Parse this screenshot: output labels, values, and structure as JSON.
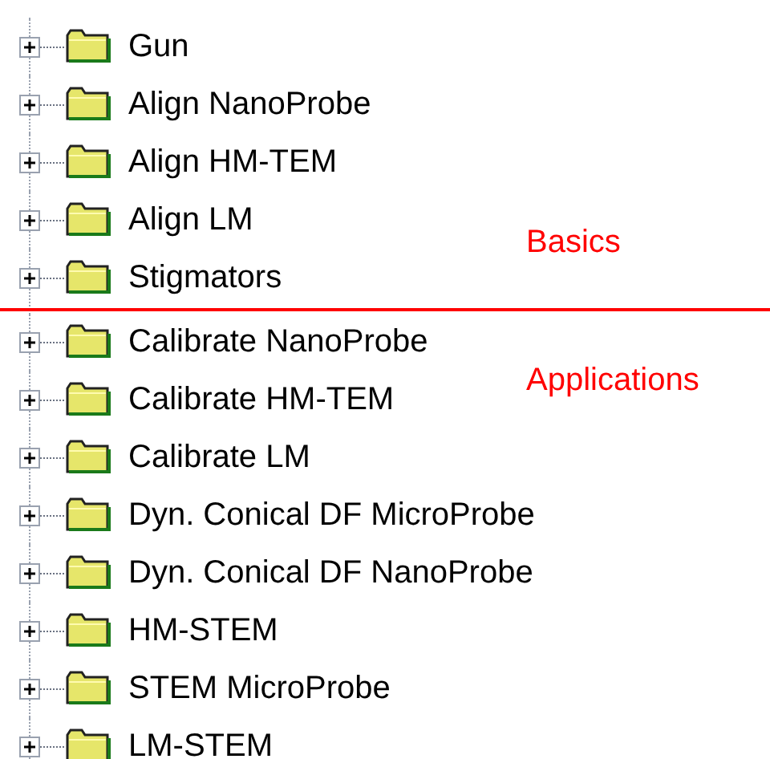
{
  "groups": [
    {
      "annotation": "Basics",
      "items": [
        {
          "label": "Gun",
          "expanded": false
        },
        {
          "label": "Align NanoProbe",
          "expanded": false
        },
        {
          "label": "Align HM-TEM",
          "expanded": false
        },
        {
          "label": "Align LM",
          "expanded": false
        },
        {
          "label": "Stigmators",
          "expanded": false
        }
      ]
    },
    {
      "annotation": "Applications",
      "items": [
        {
          "label": "Calibrate NanoProbe",
          "expanded": false
        },
        {
          "label": "Calibrate HM-TEM",
          "expanded": false
        },
        {
          "label": "Calibrate LM",
          "expanded": false
        },
        {
          "label": "Dyn. Conical DF MicroProbe",
          "expanded": false
        },
        {
          "label": "Dyn. Conical DF NanoProbe",
          "expanded": false
        },
        {
          "label": "HM-STEM",
          "expanded": false
        },
        {
          "label": "STEM MicroProbe",
          "expanded": false
        },
        {
          "label": "LM-STEM",
          "expanded": false
        }
      ]
    }
  ]
}
